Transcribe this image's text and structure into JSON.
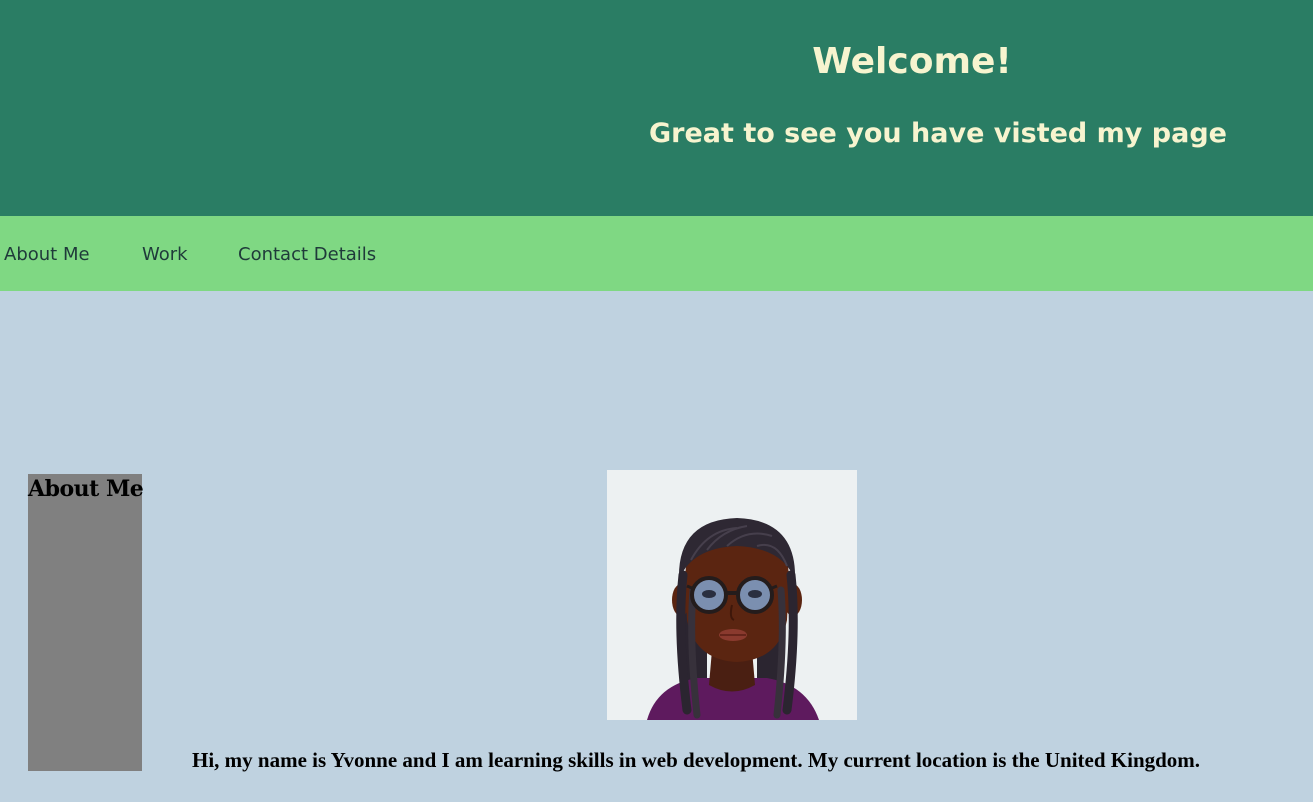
{
  "header": {
    "title": "Welcome!",
    "subtitle": "Great to see you have visted my page"
  },
  "nav": {
    "items": [
      {
        "label": "About Me"
      },
      {
        "label": "Work"
      },
      {
        "label": "Contact Details"
      }
    ]
  },
  "sidebar": {
    "heading": "About Me"
  },
  "main": {
    "avatar_icon": "avatar-portrait",
    "bio": "Hi, my name is Yvonne and I am learning skills in web development. My current location is the United Kingdom."
  },
  "colors": {
    "header_bg": "#2a7d64",
    "header_text": "#f7f4cf",
    "nav_bg": "#7fd883",
    "page_bg": "#bfd2e0",
    "sidebar_bg": "#808080"
  }
}
